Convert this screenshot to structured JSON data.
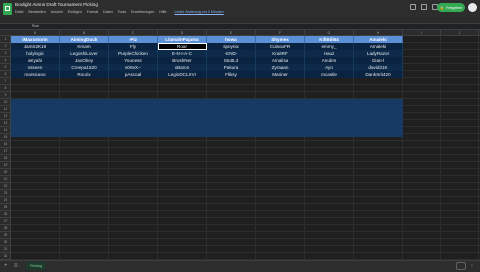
{
  "doc": {
    "title": "Boxlight Aimns Draft Tournament Picking",
    "menu": [
      "Datei",
      "Bearbeiten",
      "Ansicht",
      "Einfügen",
      "Format",
      "Daten",
      "Tools",
      "Erweiterungen",
      "Hilfe"
    ],
    "last_edit": "Letzte Änderung vor 2 Minuten",
    "share_label": "Freigeben"
  },
  "formula_bar": {
    "cell_ref": "Roar"
  },
  "columns": [
    "A",
    "B",
    "C",
    "D",
    "E",
    "F",
    "G",
    "H",
    "I",
    "J"
  ],
  "rows": [
    "1",
    "2",
    "3",
    "4",
    "5",
    "6",
    "7",
    "8",
    "9",
    "10",
    "11",
    "12",
    "13",
    "14",
    "15",
    "16",
    "17",
    "18",
    "19",
    "20",
    "21",
    "22",
    "23",
    "24",
    "25",
    "26",
    "27",
    "28",
    "29",
    "30",
    "31",
    "32"
  ],
  "table": {
    "headers": [
      "iMaxxstorm",
      "AimingDuck",
      "-Piz",
      "LlamalnPajama",
      "howa",
      "Shymex",
      "KillBill64",
      "Amaleki"
    ],
    "rows": [
      [
        "JamS2K19",
        "Kmam",
        "Fly",
        "Roar",
        "spoynix",
        "CuisouFR",
        "emmy_",
        "Amaleki"
      ],
      [
        "holylogic",
        "LegoshiLover",
        "PurpleChicken",
        "E-N-I-A-C",
        "-END-",
        "KraitRF",
        "Hauz",
        "LadyRazor"
      ],
      [
        "aKyahi",
        "JaxObey",
        "Youness",
        "BrushNer",
        "StuttL3",
        "Amalisa",
        "Anubrs",
        "Gian-l"
      ],
      [
        "nsseen",
        "Creepa1520",
        "v0rteX--",
        "xBaron",
        "Pakura",
        "Zyraaan",
        "Ayo",
        "david31K"
      ],
      [
        "marsicano",
        "Rourix",
        "pAscoal",
        "LeginDCLXVI",
        "Fliksy",
        "Mariner",
        "mcastle",
        "DankSrit420"
      ]
    ]
  },
  "sheet_tabs": [
    "Picking"
  ],
  "colors": {
    "header": "#5b8fd6",
    "data": "#0a2340",
    "band": "#163a63",
    "share": "#34a853"
  }
}
